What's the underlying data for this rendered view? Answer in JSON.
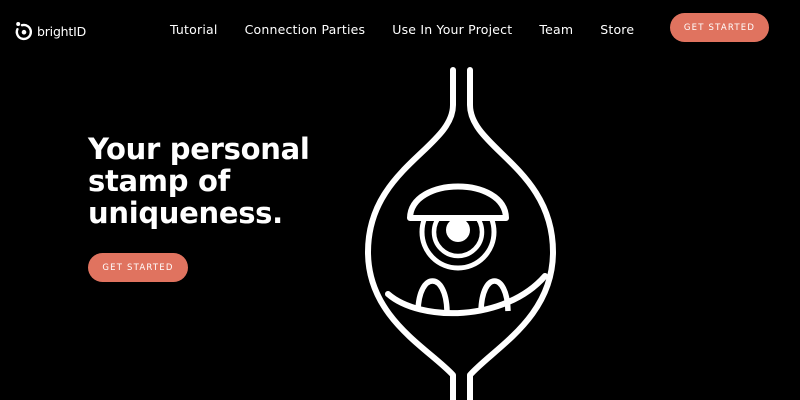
{
  "brand": {
    "name_prefix": "bright",
    "name_suffix": "ID",
    "logo_icon": "brightid-logo-icon"
  },
  "nav": {
    "items": [
      {
        "label": "Tutorial"
      },
      {
        "label": "Connection Parties"
      },
      {
        "label": "Use In Your Project"
      },
      {
        "label": "Team"
      },
      {
        "label": "Store"
      }
    ]
  },
  "header": {
    "cta_label": "GET STARTED"
  },
  "hero": {
    "title_line1": "Your personal",
    "title_line2": "stamp of",
    "title_line3": "uniqueness.",
    "cta_label": "GET STARTED",
    "illustration_icon": "one-eyed-creature-illustration"
  },
  "colors": {
    "background": "#000000",
    "text": "#ffffff",
    "accent": "#e0735f"
  }
}
